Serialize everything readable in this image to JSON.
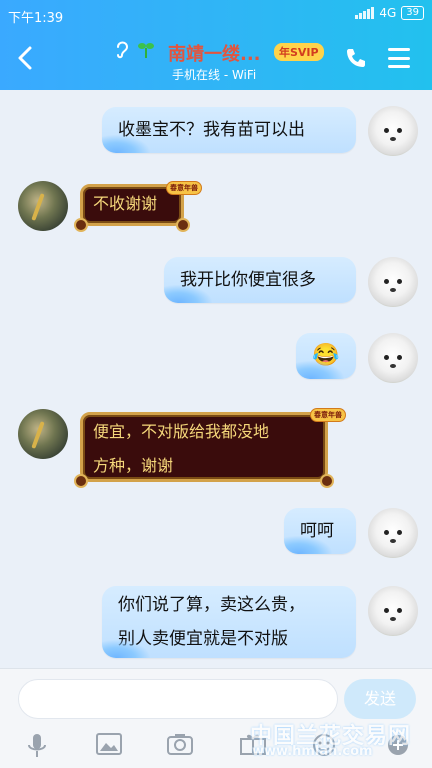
{
  "status": {
    "time": "下午1:39",
    "network": "4G",
    "battery": "39"
  },
  "header": {
    "back_icon": "chevron-left-icon",
    "title": "南靖一缕...",
    "svip_badge": "年SVIP",
    "subtitle": "手机在线 - WiFi"
  },
  "messages": [
    {
      "from": "me",
      "text": "收墨宝不？我有苗可以出"
    },
    {
      "from": "them",
      "text": "不收谢谢",
      "badge": "春意年兽"
    },
    {
      "from": "me",
      "text": "我开比你便宜很多"
    },
    {
      "from": "me",
      "text": "😂"
    },
    {
      "from": "them",
      "lines": [
        "便宜，不对版给我都没地",
        "方种，谢谢"
      ],
      "badge": "春意年兽"
    },
    {
      "from": "me",
      "text": "呵呵"
    },
    {
      "from": "me",
      "lines": [
        "你们说了算，卖这么贵，",
        "别人卖便宜就是不对版"
      ]
    }
  ],
  "input": {
    "placeholder": "",
    "send_label": "发送"
  },
  "toolbar": [
    "mic-icon",
    "image-icon",
    "camera-icon",
    "gift-icon",
    "emoji-icon",
    "more-icon"
  ],
  "watermark": {
    "line1": "中国兰花交易网",
    "line2": "www.hmlan.com"
  }
}
